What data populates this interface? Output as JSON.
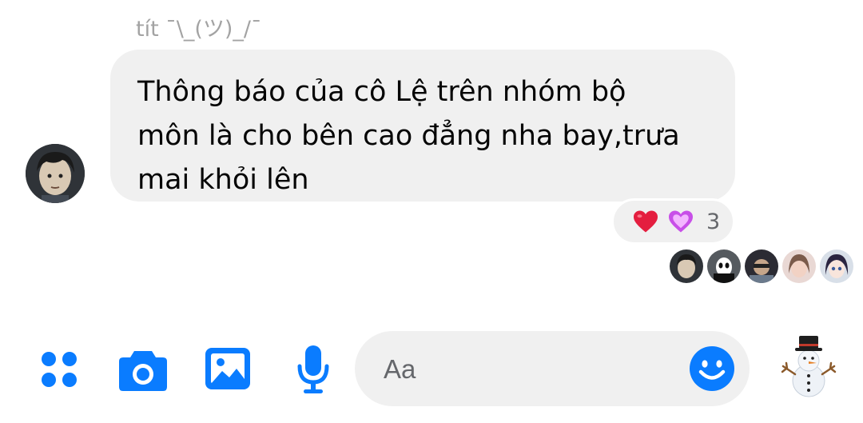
{
  "message": {
    "sender_name": "tít ¯\\_(ツ)_/¯",
    "lines": [
      "Thông báo của cô Lệ trên nhóm bộ",
      "môn là cho bên cao đẳng nha bay,trưa",
      "mai khỏi lên"
    ],
    "reactions": {
      "icons": [
        "red-heart",
        "purple-heart"
      ],
      "count": "3"
    },
    "seen_by_count": 5
  },
  "composer": {
    "placeholder": "Aa",
    "buttons": [
      "menu",
      "camera",
      "gallery",
      "microphone"
    ],
    "emoji_button": "smile-icon",
    "quick_reaction": "snowman"
  },
  "colors": {
    "accent": "#0a7cff",
    "bubble": "#f0f0f0",
    "text": "#050505",
    "muted": "#a3a3a3",
    "heart_red": "#e41e3f",
    "heart_purple": "#c84fe8"
  }
}
